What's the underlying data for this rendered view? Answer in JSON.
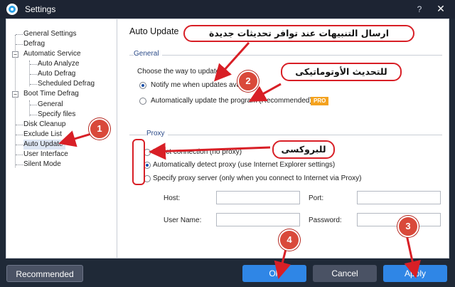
{
  "window": {
    "title": "Settings",
    "help_glyph": "?",
    "close_glyph": "✕"
  },
  "tree": {
    "items": [
      {
        "label": "General Settings",
        "level": 1
      },
      {
        "label": "Defrag",
        "level": 1
      },
      {
        "label": "Automatic Service",
        "level": 1,
        "expanded": true
      },
      {
        "label": "Auto Analyze",
        "level": 2
      },
      {
        "label": "Auto Defrag",
        "level": 2
      },
      {
        "label": "Scheduled Defrag",
        "level": 2
      },
      {
        "label": "Boot Time Defrag",
        "level": 1,
        "expanded": true
      },
      {
        "label": "General",
        "level": 2
      },
      {
        "label": "Specify files",
        "level": 2
      },
      {
        "label": "Disk Cleanup",
        "level": 1
      },
      {
        "label": "Exclude List",
        "level": 1
      },
      {
        "label": "Auto Update",
        "level": 1,
        "selected": true
      },
      {
        "label": "User Interface",
        "level": 1
      },
      {
        "label": "Silent Mode",
        "level": 1
      }
    ],
    "toggle_glyph": "−"
  },
  "main": {
    "title": "Auto Update",
    "general": {
      "label": "General",
      "prompt": "Choose the way to update:",
      "options": [
        {
          "label": "Notify me when updates available",
          "selected": true
        },
        {
          "label": "Automatically update the program (Recommended)",
          "selected": false
        }
      ],
      "pro_badge": "PRO"
    },
    "proxy": {
      "label": "Proxy",
      "options": [
        {
          "label": "Direct connection (no proxy)",
          "selected": false
        },
        {
          "label": "Automatically detect proxy (use Internet Explorer settings)",
          "selected": true
        },
        {
          "label": "Specify proxy server (only when you connect to Internet via Proxy)",
          "selected": false
        }
      ],
      "host_label": "Host:",
      "port_label": "Port:",
      "username_label": "User Name:",
      "password_label": "Password:",
      "host_value": "",
      "port_value": "",
      "username_value": "",
      "password_value": ""
    }
  },
  "footer": {
    "recommended": "Recommended",
    "ok": "Ok",
    "cancel": "Cancel",
    "apply": "Apply"
  },
  "annotations": {
    "color": "#d81f26",
    "callout_notify": "ارسال التنبيهات عند توافر تحديثات جديدة",
    "callout_auto": "للتحديث الأوتوماتيكى",
    "callout_proxy": "للبروكسى",
    "badges": [
      "1",
      "2",
      "3",
      "4"
    ]
  }
}
